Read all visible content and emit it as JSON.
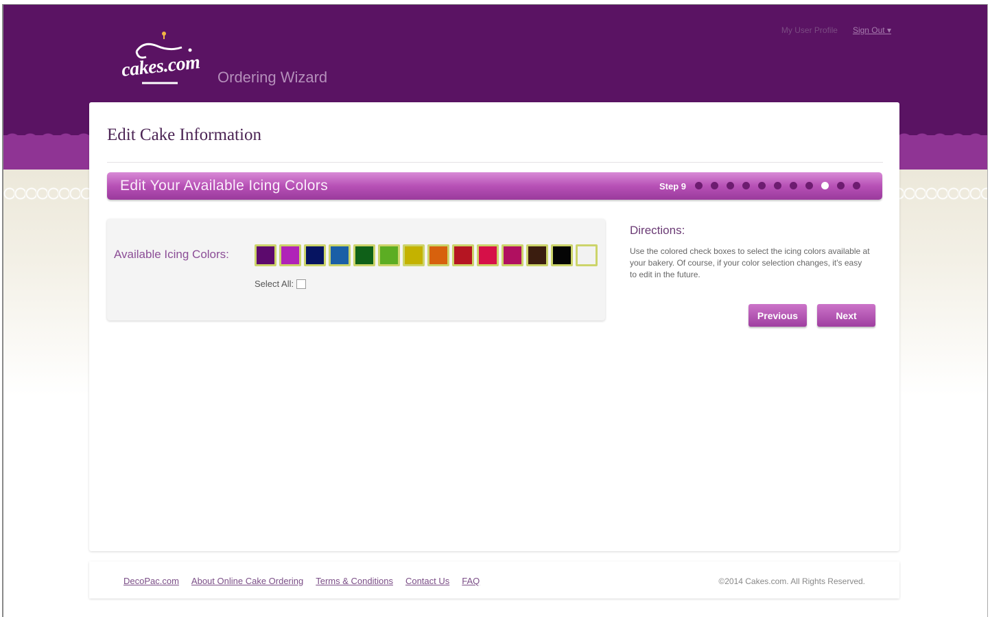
{
  "header": {
    "logo_text": "cakes.com",
    "wizard_title": "Ordering Wizard",
    "my_profile": "My User Profile",
    "sign_out": "Sign Out ▾"
  },
  "card": {
    "title": "Edit Cake Information",
    "step_title": "Edit Your Available Icing Colors",
    "step_label": "Step 9",
    "step_count": 11,
    "active_step_index": 8
  },
  "colors_panel": {
    "label": "Available Icing Colors:",
    "select_all_label": "Select All:",
    "swatch_colors": [
      "#5c0a6d",
      "#b023b8",
      "#061461",
      "#1b5fa6",
      "#0f6018",
      "#5cad23",
      "#c4b200",
      "#d7610d",
      "#b51522",
      "#d61048",
      "#b01060",
      "#3b1d0f",
      "#050505",
      "#f2f2f2"
    ]
  },
  "directions": {
    "title": "Directions:",
    "text": "Use the colored check boxes to select the icing colors available at your bakery. Of course, if your color selection changes, it's easy to edit in the future."
  },
  "buttons": {
    "previous": "Previous",
    "next": "Next"
  },
  "footer": {
    "links": [
      "DecoPac.com",
      "About Online Cake Ordering",
      "Terms & Conditions",
      "Contact Us",
      "FAQ"
    ],
    "copyright": "©2014 Cakes.com. All Rights Reserved."
  }
}
